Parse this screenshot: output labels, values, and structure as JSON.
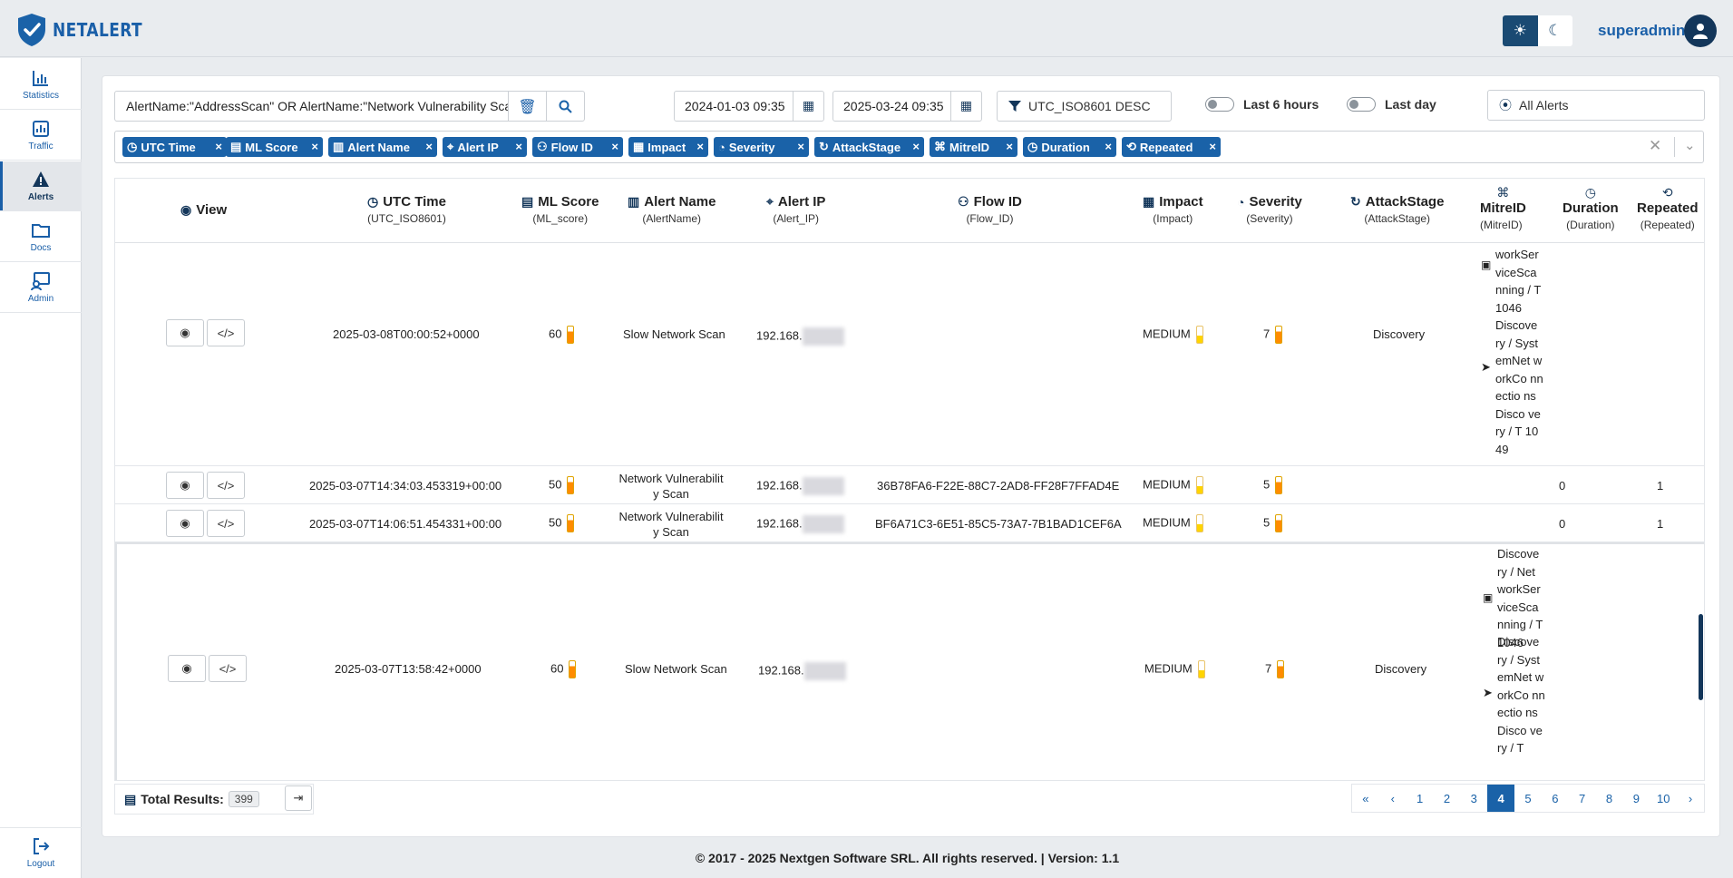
{
  "app": {
    "logo_text": "NETALERT",
    "user_name": "superadmin",
    "brand_color": "#1a62a8",
    "accent_dark": "#13365a"
  },
  "sidebar": {
    "items": [
      {
        "label": "Statistics",
        "icon": "bar-chart-icon"
      },
      {
        "label": "Traffic",
        "icon": "line-chart-icon"
      },
      {
        "label": "Alerts",
        "icon": "warning-icon",
        "active": true
      },
      {
        "label": "Docs",
        "icon": "folder-icon"
      },
      {
        "label": "Admin",
        "icon": "admin-icon"
      }
    ],
    "logout_label": "Logout"
  },
  "filters": {
    "query": "AlertName:\"AddressScan\" OR AlertName:\"Network Vulnerability Scan\" OR AlertName:\"Slow Network Scan\"",
    "date_from": "2024-01-03 09:35",
    "date_to": "2025-03-24 09:35",
    "sort": "UTC_ISO8601 DESC",
    "toggle_6h": "Last 6 hours",
    "toggle_day": "Last day",
    "alert_scope": "All Alerts"
  },
  "chips": [
    "UTC Time",
    "ML Score",
    "Alert Name",
    "Alert IP",
    "Flow ID",
    "Impact",
    "Severity",
    "AttackStage",
    "MitreID",
    "Duration",
    "Repeated"
  ],
  "columns": [
    {
      "title": "View",
      "field": ""
    },
    {
      "title": "UTC Time",
      "field": "(UTC_ISO8601)"
    },
    {
      "title": "ML Score",
      "field": "(ML_score)"
    },
    {
      "title": "Alert Name",
      "field": "(AlertName)"
    },
    {
      "title": "Alert IP",
      "field": "(Alert_IP)"
    },
    {
      "title": "Flow ID",
      "field": "(Flow_ID)"
    },
    {
      "title": "Impact",
      "field": "(Impact)"
    },
    {
      "title": "Severity",
      "field": "(Severity)"
    },
    {
      "title": "AttackStage",
      "field": "(AttackStage)"
    },
    {
      "title": "MitreID",
      "field": "(MitreID)"
    },
    {
      "title": "Duration",
      "field": "(Duration)"
    },
    {
      "title": "Repeated",
      "field": "(Repeated)"
    }
  ],
  "rows": [
    {
      "time": "2025-03-08T00:00:52+0000",
      "ml_score": "60",
      "alert_name": "Slow Network Scan",
      "ip_prefix": "192.168.",
      "flow_id": "",
      "impact": "MEDIUM",
      "severity": "7",
      "attack_stage": "Discovery",
      "mitre_part1": "workSer viceSca nning / T1046",
      "mitre_part2": "Discove ry / Syst emNet workCo nnectio nsDisco very / T 1049",
      "duration": "",
      "repeated": ""
    },
    {
      "time": "2025-03-07T14:34:03.453319+00:00",
      "ml_score": "50",
      "alert_name": "Network Vulnerabilit y Scan",
      "ip_prefix": "192.168.",
      "flow_id": "36B78FA6-F22E-88C7-2AD8-FF28F7FFAD4E",
      "impact": "MEDIUM",
      "severity": "5",
      "attack_stage": "",
      "duration": "0",
      "repeated": "1"
    },
    {
      "time": "2025-03-07T14:06:51.454331+00:00",
      "ml_score": "50",
      "alert_name": "Network Vulnerabilit y Scan",
      "ip_prefix": "192.168.",
      "flow_id": "BF6A71C3-6E51-85C5-73A7-7B1BAD1CEF6A",
      "impact": "MEDIUM",
      "severity": "5",
      "attack_stage": "",
      "duration": "0",
      "repeated": "1"
    },
    {
      "time": "2025-03-07T13:58:42+0000",
      "ml_score": "60",
      "alert_name": "Slow Network Scan",
      "ip_prefix": "192.168.",
      "flow_id": "",
      "impact": "MEDIUM",
      "severity": "7",
      "attack_stage": "Discovery",
      "mitre_part1": "Discove ry / Net workSer viceSca nning / T1046",
      "mitre_part2": "Discove ry / Syst emNet workCo nnectio nsDisco very / T",
      "duration": "",
      "repeated": ""
    }
  ],
  "total": {
    "label": "Total Results:",
    "count": "399"
  },
  "pagination": {
    "first": "«",
    "prev": "‹",
    "pages": [
      "1",
      "2",
      "3",
      "4",
      "5",
      "6",
      "7",
      "8",
      "9",
      "10"
    ],
    "current": "4",
    "next": "›"
  },
  "footer": "© 2017 - 2025 Nextgen Software SRL. All rights reserved. | Version: 1.1"
}
